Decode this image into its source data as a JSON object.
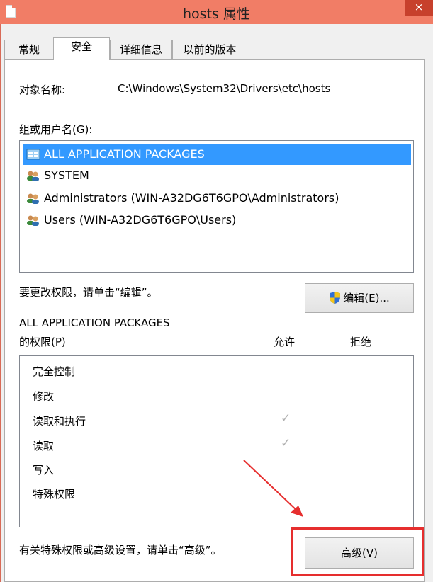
{
  "window": {
    "title": "hosts 属性",
    "close": "×"
  },
  "tabs": [
    {
      "label": "常规"
    },
    {
      "label": "安全"
    },
    {
      "label": "详细信息"
    },
    {
      "label": "以前的版本"
    }
  ],
  "object": {
    "label": "对象名称:",
    "value": "C:\\Windows\\System32\\Drivers\\etc\\hosts"
  },
  "groups": {
    "label": "组或用户名(G):",
    "items": [
      {
        "name": "ALL APPLICATION PACKAGES",
        "icon": "packages-icon"
      },
      {
        "name": "SYSTEM",
        "icon": "user-group-icon"
      },
      {
        "name": "Administrators (WIN-A32DG6T6GPO\\Administrators)",
        "icon": "user-group-icon"
      },
      {
        "name": "Users (WIN-A32DG6T6GPO\\Users)",
        "icon": "user-group-icon"
      }
    ]
  },
  "edit": {
    "hint": "要更改权限，请单击“编辑”。",
    "button": "编辑(E)..."
  },
  "permissions": {
    "title_line1": "ALL APPLICATION PACKAGES",
    "title_line2": "的权限(P)",
    "allow": "允许",
    "deny": "拒绝",
    "check_mark": "✓",
    "rows": [
      {
        "name": "完全控制",
        "allow": false
      },
      {
        "name": "修改",
        "allow": false
      },
      {
        "name": "读取和执行",
        "allow": true
      },
      {
        "name": "读取",
        "allow": true
      },
      {
        "name": "写入",
        "allow": false
      },
      {
        "name": "特殊权限",
        "allow": false
      }
    ]
  },
  "advanced": {
    "hint": "有关特殊权限或高级设置，请单击“高级”。",
    "button": "高级(V)"
  },
  "colors": {
    "title_bar": "#f17d66",
    "selection": "#3399ff",
    "annotation": "#e62e2e"
  }
}
